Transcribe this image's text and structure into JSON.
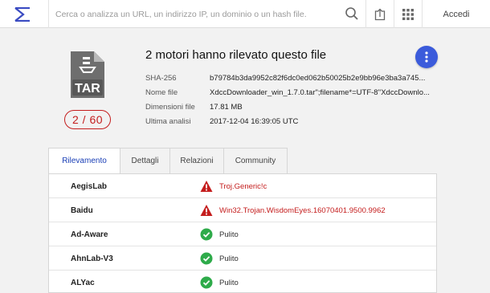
{
  "header": {
    "search_placeholder": "Cerca o analizza un URL, un indirizzo IP, un dominio o un hash file.",
    "login_label": "Accedi",
    "icons": [
      "sigma-logo-icon",
      "search-icon",
      "upload-icon",
      "apps-grid-icon"
    ]
  },
  "file": {
    "type_label": "TAR",
    "score": "2 / 60",
    "headline": "2 motori hanno rilevato questo file",
    "details": [
      {
        "label": "SHA-256",
        "value": "b79784b3da9952c82f6dc0ed062b50025b2e9bb96e3ba3a745..."
      },
      {
        "label": "Nome file",
        "value": "XdccDownloader_win_1.7.0.tar\";filename*=UTF-8''XdccDownlo..."
      },
      {
        "label": "Dimensioni file",
        "value": "17.81 MB"
      },
      {
        "label": "Ultima analisi",
        "value": "2017-12-04 16:39:05 UTC"
      }
    ]
  },
  "tabs": [
    "Rilevamento",
    "Dettagli",
    "Relazioni",
    "Community"
  ],
  "active_tab": "Rilevamento",
  "detections": [
    {
      "engine": "AegisLab",
      "result": "Troj.Generic!c",
      "status": "malicious"
    },
    {
      "engine": "Baidu",
      "result": "Win32.Trojan.WisdomEyes.16070401.9500.9962",
      "status": "malicious"
    },
    {
      "engine": "Ad-Aware",
      "result": "Pulito",
      "status": "clean"
    },
    {
      "engine": "AhnLab-V3",
      "result": "Pulito",
      "status": "clean"
    },
    {
      "engine": "ALYac",
      "result": "Pulito",
      "status": "clean"
    }
  ],
  "colors": {
    "accent": "#3b5bdb",
    "tab_active_text": "#1a3fb6",
    "malicious": "#c41d1d",
    "clean": "#2eab4a",
    "logo": "#3a4bc2"
  }
}
